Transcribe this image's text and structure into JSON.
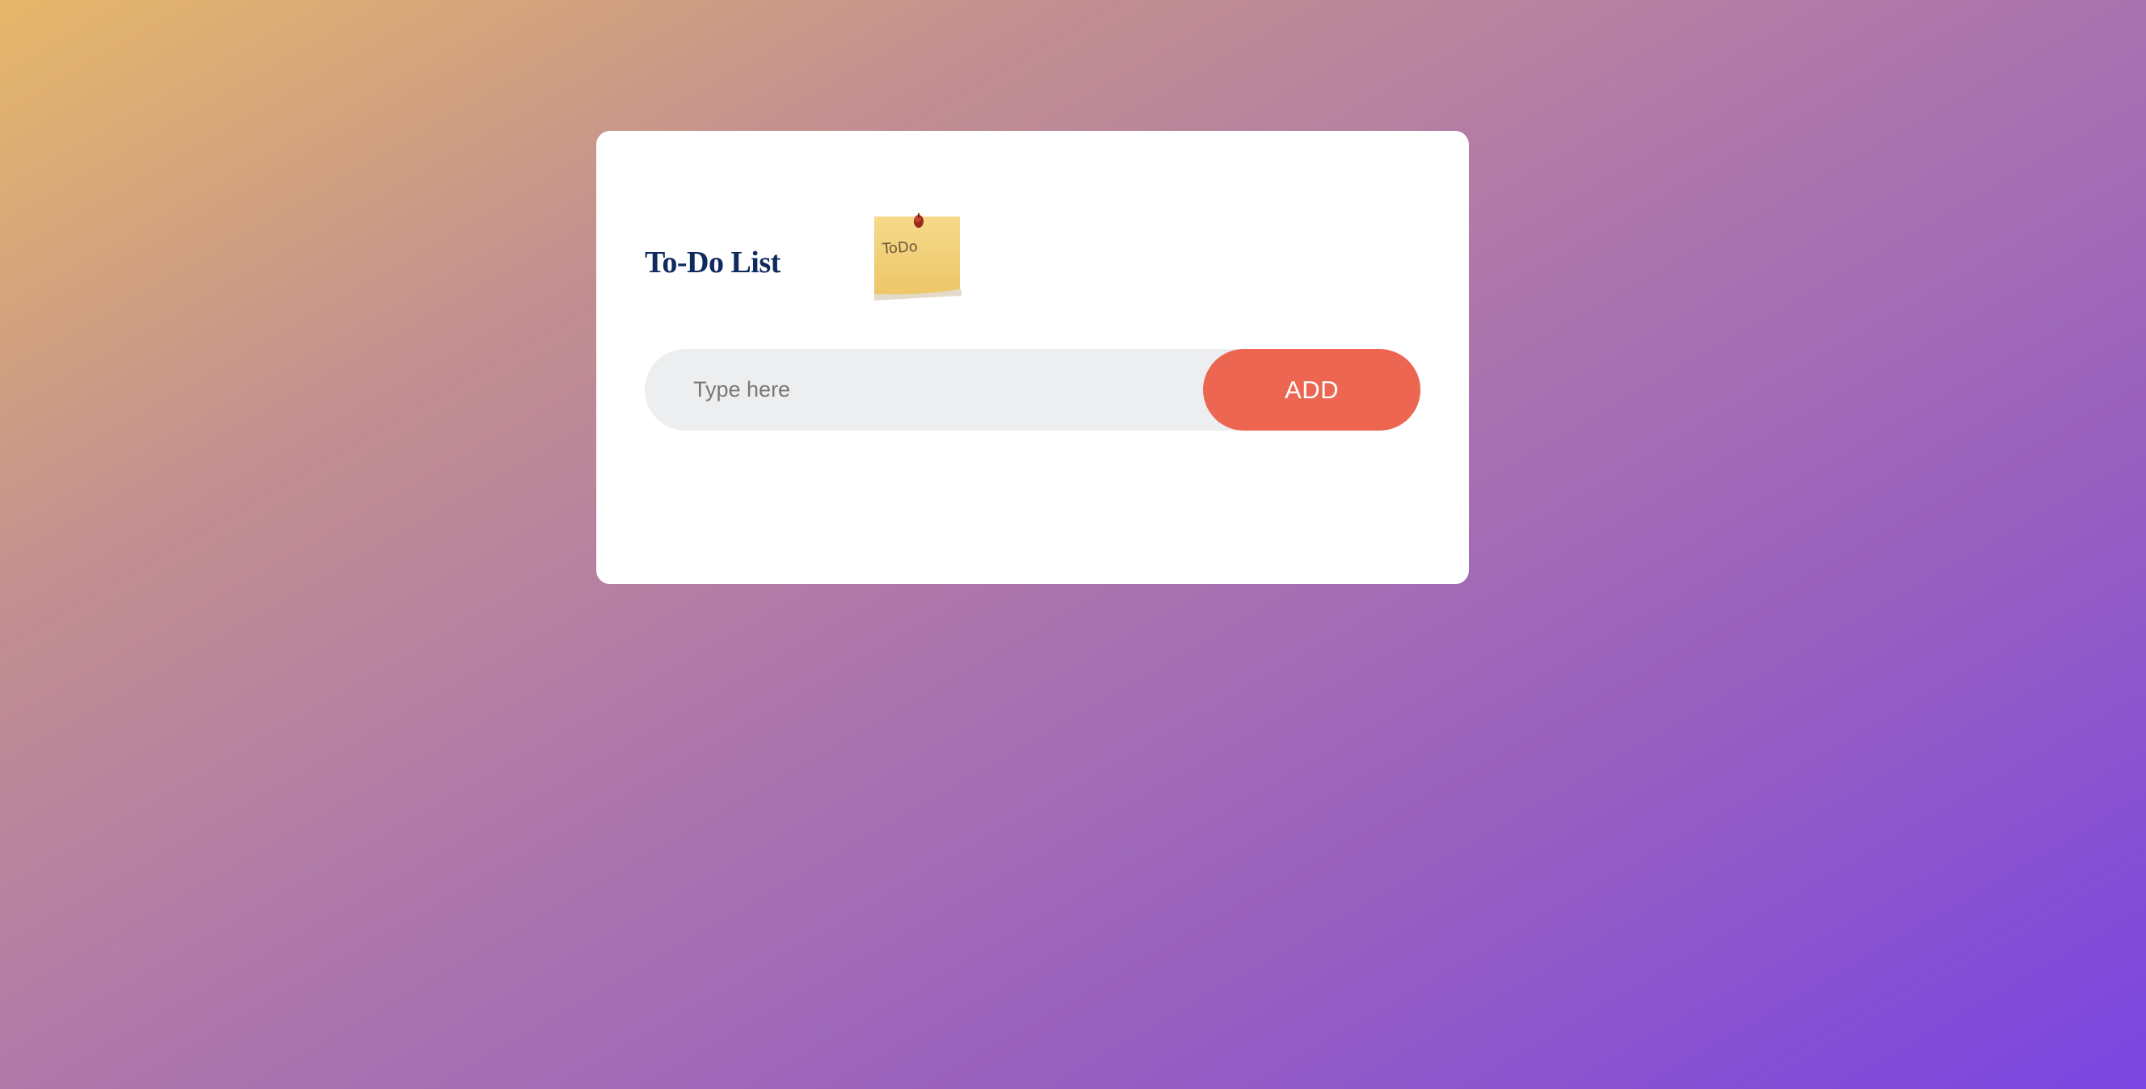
{
  "app": {
    "title": "To-Do List",
    "note_icon": "sticky-note-todo-icon",
    "note_icon_text": "ToDo"
  },
  "input": {
    "placeholder": "Type here",
    "value": ""
  },
  "add_button": {
    "label": "ADD"
  },
  "tasks": [],
  "colors": {
    "accent": "#ec6652",
    "title": "#0f2a5e",
    "input_bg": "#edeef0",
    "gradient_start": "#e6b86a",
    "gradient_end": "#7a45e2"
  }
}
